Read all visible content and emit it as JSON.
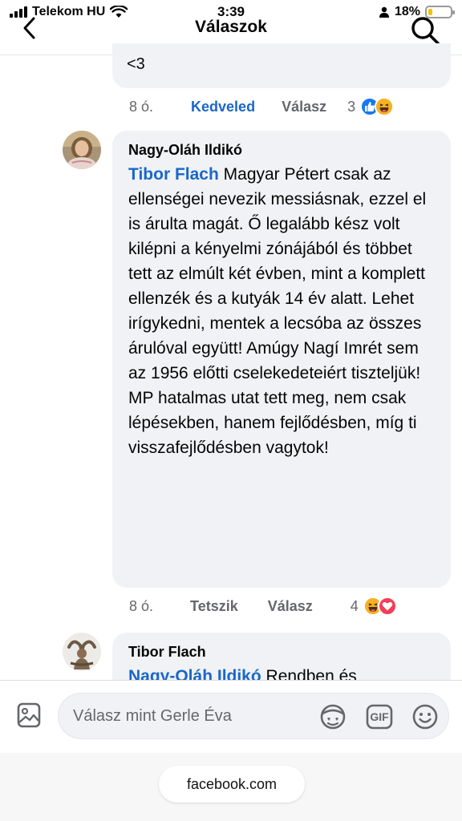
{
  "status_bar": {
    "carrier": "Telekom HU",
    "time": "3:39",
    "battery_percent": "18%",
    "battery_level": 0.18
  },
  "header": {
    "title": "Válaszok",
    "back_icon": "chevron-left-icon",
    "search_icon": "search-icon"
  },
  "previous_comment": {
    "text_tail": "<3",
    "time": "8 ó.",
    "like_label": "Kedveled",
    "reply_label": "Válasz",
    "reaction_count": "3",
    "reactions": [
      "like-icon",
      "haha-icon"
    ]
  },
  "comment_main": {
    "author": "Nagy-Oláh Ildikó",
    "mention": "Tibor Flach",
    "text": "Magyar Pétert csak az ellenségei nevezik messiásnak, ezzel el is árulta magát. Ő legalább kész volt kilépni a kényelmi zónájából és többet tett az elmúlt két évben, mint a komplett ellenzék és a kutyák 14 év alatt. Lehet irígykedni, mentek a lecsóba az összes árulóval együtt! Amúgy Nagí Imrét sem az 1956 előtti cselekedeteiért tiszteljük! MP hatalmas utat tett meg, nem csak lépésekben, hanem fejlődésben, míg ti visszafejlődésben vagytok!",
    "time": "8 ó.",
    "like_label": "Tetszik",
    "reply_label": "Válasz",
    "reaction_count": "4",
    "reactions": [
      "haha-icon",
      "love-icon"
    ]
  },
  "comment_next": {
    "author": "Tibor Flach",
    "mention": "Nagy-Oláh Ildikó",
    "text": "Rendben és"
  },
  "composer": {
    "placeholder": "Válasz mint Gerle Éva",
    "gif_label": "GIF"
  },
  "browser": {
    "url": "facebook.com"
  },
  "colors": {
    "accent": "#1a66c9",
    "bubble": "#f0f2f5",
    "meta_text": "#65676b",
    "love": "#f33e58",
    "haha": "#f7b125"
  }
}
